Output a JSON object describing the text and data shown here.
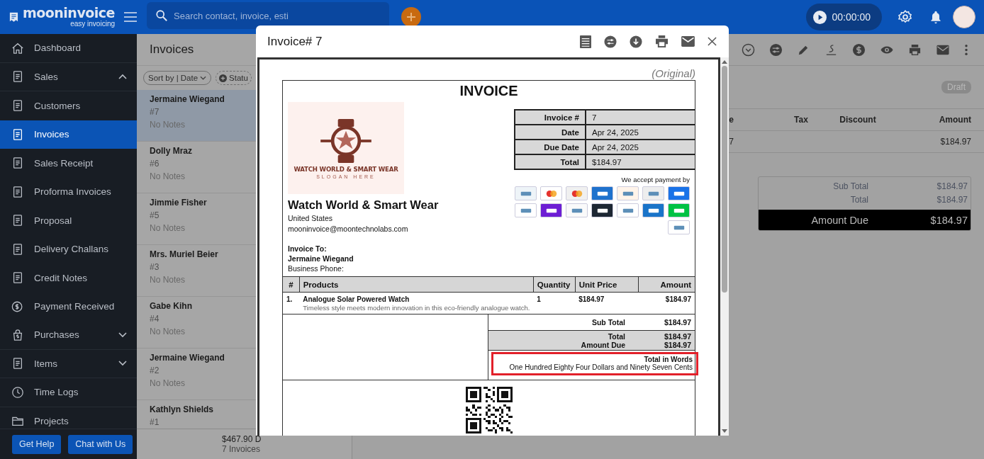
{
  "topbar": {
    "brand": "mooninvoice",
    "tagline": "easy invoicing",
    "search": {
      "placeholder": "Search contact, invoice, esti"
    },
    "timer": "00:00:00"
  },
  "sidebar": {
    "items": [
      {
        "label": "Dashboard",
        "selected": false
      },
      {
        "label": "Sales",
        "selected": false,
        "expanded": true,
        "children": [
          {
            "label": "Customers",
            "selected": false
          },
          {
            "label": "Invoices",
            "selected": true
          },
          {
            "label": "Sales Receipt",
            "selected": false
          },
          {
            "label": "Proforma Invoices",
            "selected": false
          },
          {
            "label": "Proposal",
            "selected": false
          },
          {
            "label": "Delivery Challans",
            "selected": false
          },
          {
            "label": "Credit Notes",
            "selected": false
          },
          {
            "label": "Payment Received",
            "selected": false
          }
        ]
      },
      {
        "label": "Purchases",
        "selected": false,
        "expanded": false
      },
      {
        "label": "Items",
        "selected": false,
        "expanded": false
      },
      {
        "label": "Time Logs",
        "selected": false
      },
      {
        "label": "Projects",
        "selected": false
      }
    ],
    "buttons": [
      "Get Help",
      "Chat with Us"
    ]
  },
  "invoice_list": {
    "title": "Invoices",
    "sort": "Sort by | Date",
    "filter": "Statu",
    "items": [
      {
        "name": "Jermaine Wiegand",
        "number": "#7",
        "notes": "No Notes",
        "selected": true
      },
      {
        "name": "Dolly Mraz",
        "number": "#6",
        "notes": "No Notes",
        "selected": false
      },
      {
        "name": "Jimmie Fisher",
        "number": "#5",
        "notes": "No Notes",
        "selected": false
      },
      {
        "name": "Mrs. Muriel Beier",
        "number": "#3",
        "notes": "No Notes",
        "selected": false
      },
      {
        "name": "Gabe Kihn",
        "number": "#4",
        "notes": "No Notes",
        "selected": false
      },
      {
        "name": "Jermaine Wiegand",
        "number": "#2",
        "notes": "No Notes",
        "selected": false
      },
      {
        "name": "Kathlyn Shields",
        "number": "#1",
        "selected": false
      }
    ],
    "total": "$467.90 D",
    "count": "7 Invoices"
  },
  "detail": {
    "status": "Draft",
    "table": {
      "columns": [
        "e",
        "Tax",
        "Discount",
        "Amount"
      ],
      "rows": [
        {
          "column_1": "7",
          "amount": "$184.97"
        }
      ]
    },
    "totals": [
      {
        "label": "Sub Total",
        "value": "$184.97"
      },
      {
        "label": "Total",
        "value": "$184.97"
      }
    ],
    "amount_due": {
      "label": "Amount Due",
      "value": "$184.97"
    }
  },
  "modal": {
    "title": "Invoice# 7",
    "document": {
      "copy_label": "(Original)",
      "heading": "INVOICE",
      "logo": {
        "name": "WATCH WORLD & SMART WEAR",
        "slogan": "SLOGAN HERE"
      },
      "company": {
        "name": "Watch World  & Smart Wear",
        "country": "United States",
        "email": "mooninvoice@moontechnolabs.com"
      },
      "meta": [
        {
          "label": "Invoice #",
          "value": "7"
        },
        {
          "label": "Date",
          "value": "Apr 24, 2025"
        },
        {
          "label": "Due Date",
          "value": "Apr 24, 2025"
        },
        {
          "label": "Total",
          "value": "$184.97"
        }
      ],
      "payment": {
        "title": "We accept payment by",
        "methods": [
          {
            "kind": "mark",
            "color": "#eef4f8"
          },
          {
            "kind": "circles",
            "color": "#ffffff"
          },
          {
            "kind": "circles",
            "color": "#f0f0f0"
          },
          {
            "kind": "mark",
            "color": "#1f72cd"
          },
          {
            "kind": "mark",
            "color": "#fff4ea"
          },
          {
            "kind": "mark",
            "color": "#eeeeee"
          },
          {
            "kind": "mark",
            "color": "#1a73e8"
          },
          {
            "kind": "mark",
            "color": "#ffffff"
          },
          {
            "kind": "mark",
            "color": "#6d1ed4"
          },
          {
            "kind": "mark",
            "color": "#fafafa"
          },
          {
            "kind": "mark",
            "color": "#1d2733"
          },
          {
            "kind": "mark",
            "color": "#ffffff"
          },
          {
            "kind": "mark",
            "color": "#1a74c9"
          },
          {
            "kind": "mark",
            "color": "#00c244"
          },
          {
            "kind": "mark",
            "color": "#ffffff"
          }
        ]
      },
      "bill_to": {
        "heading": "Invoice To:",
        "name": "Jermaine Wiegand",
        "phone_label": "Business Phone:"
      },
      "table": {
        "columns": [
          "#",
          "Products",
          "Quantity",
          "Unit Price",
          "Amount"
        ],
        "rows": [
          {
            "index": "1.",
            "product": "Analogue Solar Powered Watch",
            "description": "Timeless style meets modern innovation in this eco-friendly analogue watch.",
            "quantity": "1",
            "unit_price": "$184.97",
            "amount": "$184.97"
          }
        ]
      },
      "sub_total": {
        "label": "Sub Total",
        "value": "$184.97"
      },
      "grand": [
        {
          "label": "Total",
          "value": "$184.97"
        },
        {
          "label": "Amount Due",
          "value": "$184.97"
        }
      ],
      "in_words": {
        "label": "Total in Words",
        "text": "One Hundred Eighty Four Dollars and Ninety Seven Cents",
        "highlighted": true
      }
    }
  }
}
